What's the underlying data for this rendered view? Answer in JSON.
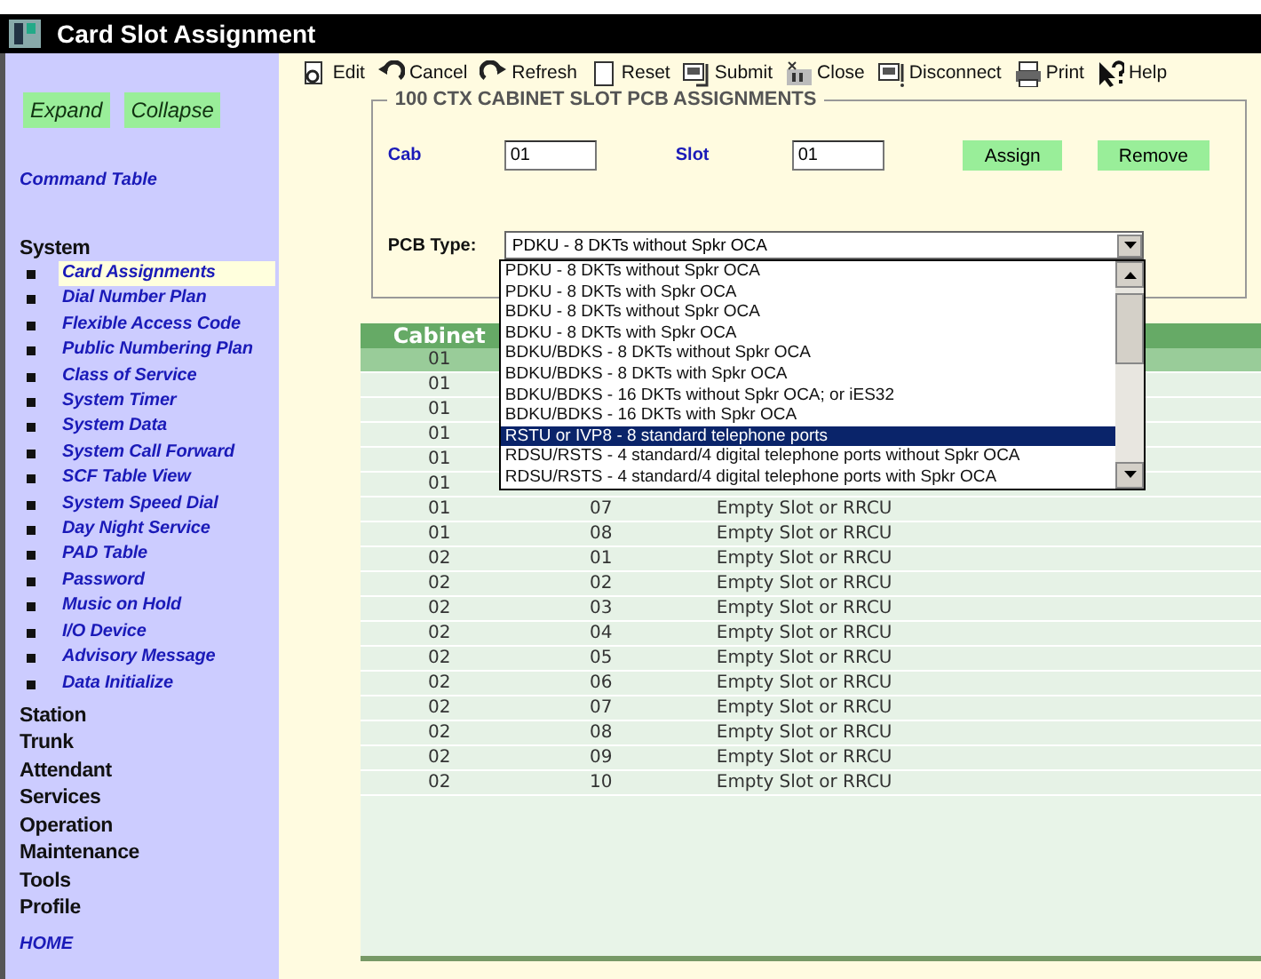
{
  "window": {
    "title": "Card Slot Assignment"
  },
  "sidebar": {
    "buttons": [
      "Expand",
      "Collapse"
    ],
    "command_table": "Command Table",
    "sections": [
      {
        "label": "System",
        "items": [
          {
            "label": "Card Assignments",
            "selected": true
          },
          {
            "label": "Dial Number Plan",
            "selected": false
          },
          {
            "label": "Flexible Access Code",
            "selected": false
          },
          {
            "label": "Public Numbering Plan",
            "selected": false
          },
          {
            "label": "Class of Service",
            "selected": false
          },
          {
            "label": "System Timer",
            "selected": false
          },
          {
            "label": "System Data",
            "selected": false
          },
          {
            "label": "System Call Forward",
            "selected": false
          },
          {
            "label": "SCF Table View",
            "selected": false
          },
          {
            "label": "System Speed Dial",
            "selected": false
          },
          {
            "label": "Day Night Service",
            "selected": false
          },
          {
            "label": "PAD Table",
            "selected": false
          },
          {
            "label": "Password",
            "selected": false
          },
          {
            "label": "Music on Hold",
            "selected": false
          },
          {
            "label": "I/O Device",
            "selected": false
          },
          {
            "label": "Advisory Message",
            "selected": false
          },
          {
            "label": "Data Initialize",
            "selected": false
          }
        ]
      },
      {
        "label": "Station"
      },
      {
        "label": "Trunk"
      },
      {
        "label": "Attendant"
      },
      {
        "label": "Services"
      },
      {
        "label": "Operation"
      },
      {
        "label": "Maintenance"
      },
      {
        "label": "Tools"
      },
      {
        "label": "Profile"
      }
    ],
    "home": "HOME"
  },
  "toolbar": [
    "Edit",
    "Cancel",
    "Refresh",
    "Reset",
    "Submit",
    "Close",
    "Disconnect",
    "Print",
    "Help"
  ],
  "form": {
    "legend": "100 CTX CABINET SLOT PCB ASSIGNMENTS",
    "cab_label": "Cab",
    "cab_value": "01",
    "slot_label": "Slot",
    "slot_value": "01",
    "buttons": [
      "Assign",
      "Remove"
    ],
    "pcb_label": "PCB Type:",
    "pcb_value": "PDKU - 8 DKTs without Spkr OCA",
    "pcb_options": [
      {
        "label": "PDKU - 8 DKTs without Spkr OCA",
        "selected": false
      },
      {
        "label": "PDKU - 8 DKTs with Spkr OCA",
        "selected": false
      },
      {
        "label": "BDKU - 8 DKTs without Spkr OCA",
        "selected": false
      },
      {
        "label": "BDKU - 8 DKTs with Spkr OCA",
        "selected": false
      },
      {
        "label": "BDKU/BDKS - 8 DKTs without Spkr OCA",
        "selected": false
      },
      {
        "label": "BDKU/BDKS - 8 DKTs with Spkr OCA",
        "selected": false
      },
      {
        "label": "BDKU/BDKS - 16 DKTs without Spkr OCA; or iES32",
        "selected": false
      },
      {
        "label": "BDKU/BDKS - 16 DKTs with Spkr OCA",
        "selected": false
      },
      {
        "label": "RSTU or IVP8 - 8 standard telephone ports",
        "selected": true
      },
      {
        "label": "RDSU/RSTS - 4 standard/4 digital telephone ports without Spkr OCA",
        "selected": false
      },
      {
        "label": "RDSU/RSTS - 4 standard/4 digital telephone ports with Spkr OCA",
        "selected": false
      }
    ]
  },
  "table": {
    "columns": [
      "Cabinet"
    ],
    "rows": [
      {
        "cells": [
          "01"
        ],
        "selected": true
      },
      {
        "cells": [
          "01"
        ],
        "selected": false
      },
      {
        "cells": [
          "01"
        ],
        "selected": false
      },
      {
        "cells": [
          "01"
        ],
        "selected": false
      },
      {
        "cells": [
          "01"
        ],
        "selected": false
      },
      {
        "cells": [
          "01"
        ],
        "selected": false
      },
      {
        "cells": [
          "01",
          "07",
          "Empty Slot or RRCU"
        ],
        "selected": false
      },
      {
        "cells": [
          "01",
          "08",
          "Empty Slot or RRCU"
        ],
        "selected": false
      },
      {
        "cells": [
          "02",
          "01",
          "Empty Slot or RRCU"
        ],
        "selected": false
      },
      {
        "cells": [
          "02",
          "02",
          "Empty Slot or RRCU"
        ],
        "selected": false
      },
      {
        "cells": [
          "02",
          "03",
          "Empty Slot or RRCU"
        ],
        "selected": false
      },
      {
        "cells": [
          "02",
          "04",
          "Empty Slot or RRCU"
        ],
        "selected": false
      },
      {
        "cells": [
          "02",
          "05",
          "Empty Slot or RRCU"
        ],
        "selected": false
      },
      {
        "cells": [
          "02",
          "06",
          "Empty Slot or RRCU"
        ],
        "selected": false
      },
      {
        "cells": [
          "02",
          "07",
          "Empty Slot or RRCU"
        ],
        "selected": false
      },
      {
        "cells": [
          "02",
          "08",
          "Empty Slot or RRCU"
        ],
        "selected": false
      },
      {
        "cells": [
          "02",
          "09",
          "Empty Slot or RRCU"
        ],
        "selected": false
      },
      {
        "cells": [
          "02",
          "10",
          "Empty Slot or RRCU"
        ],
        "selected": false
      }
    ]
  }
}
